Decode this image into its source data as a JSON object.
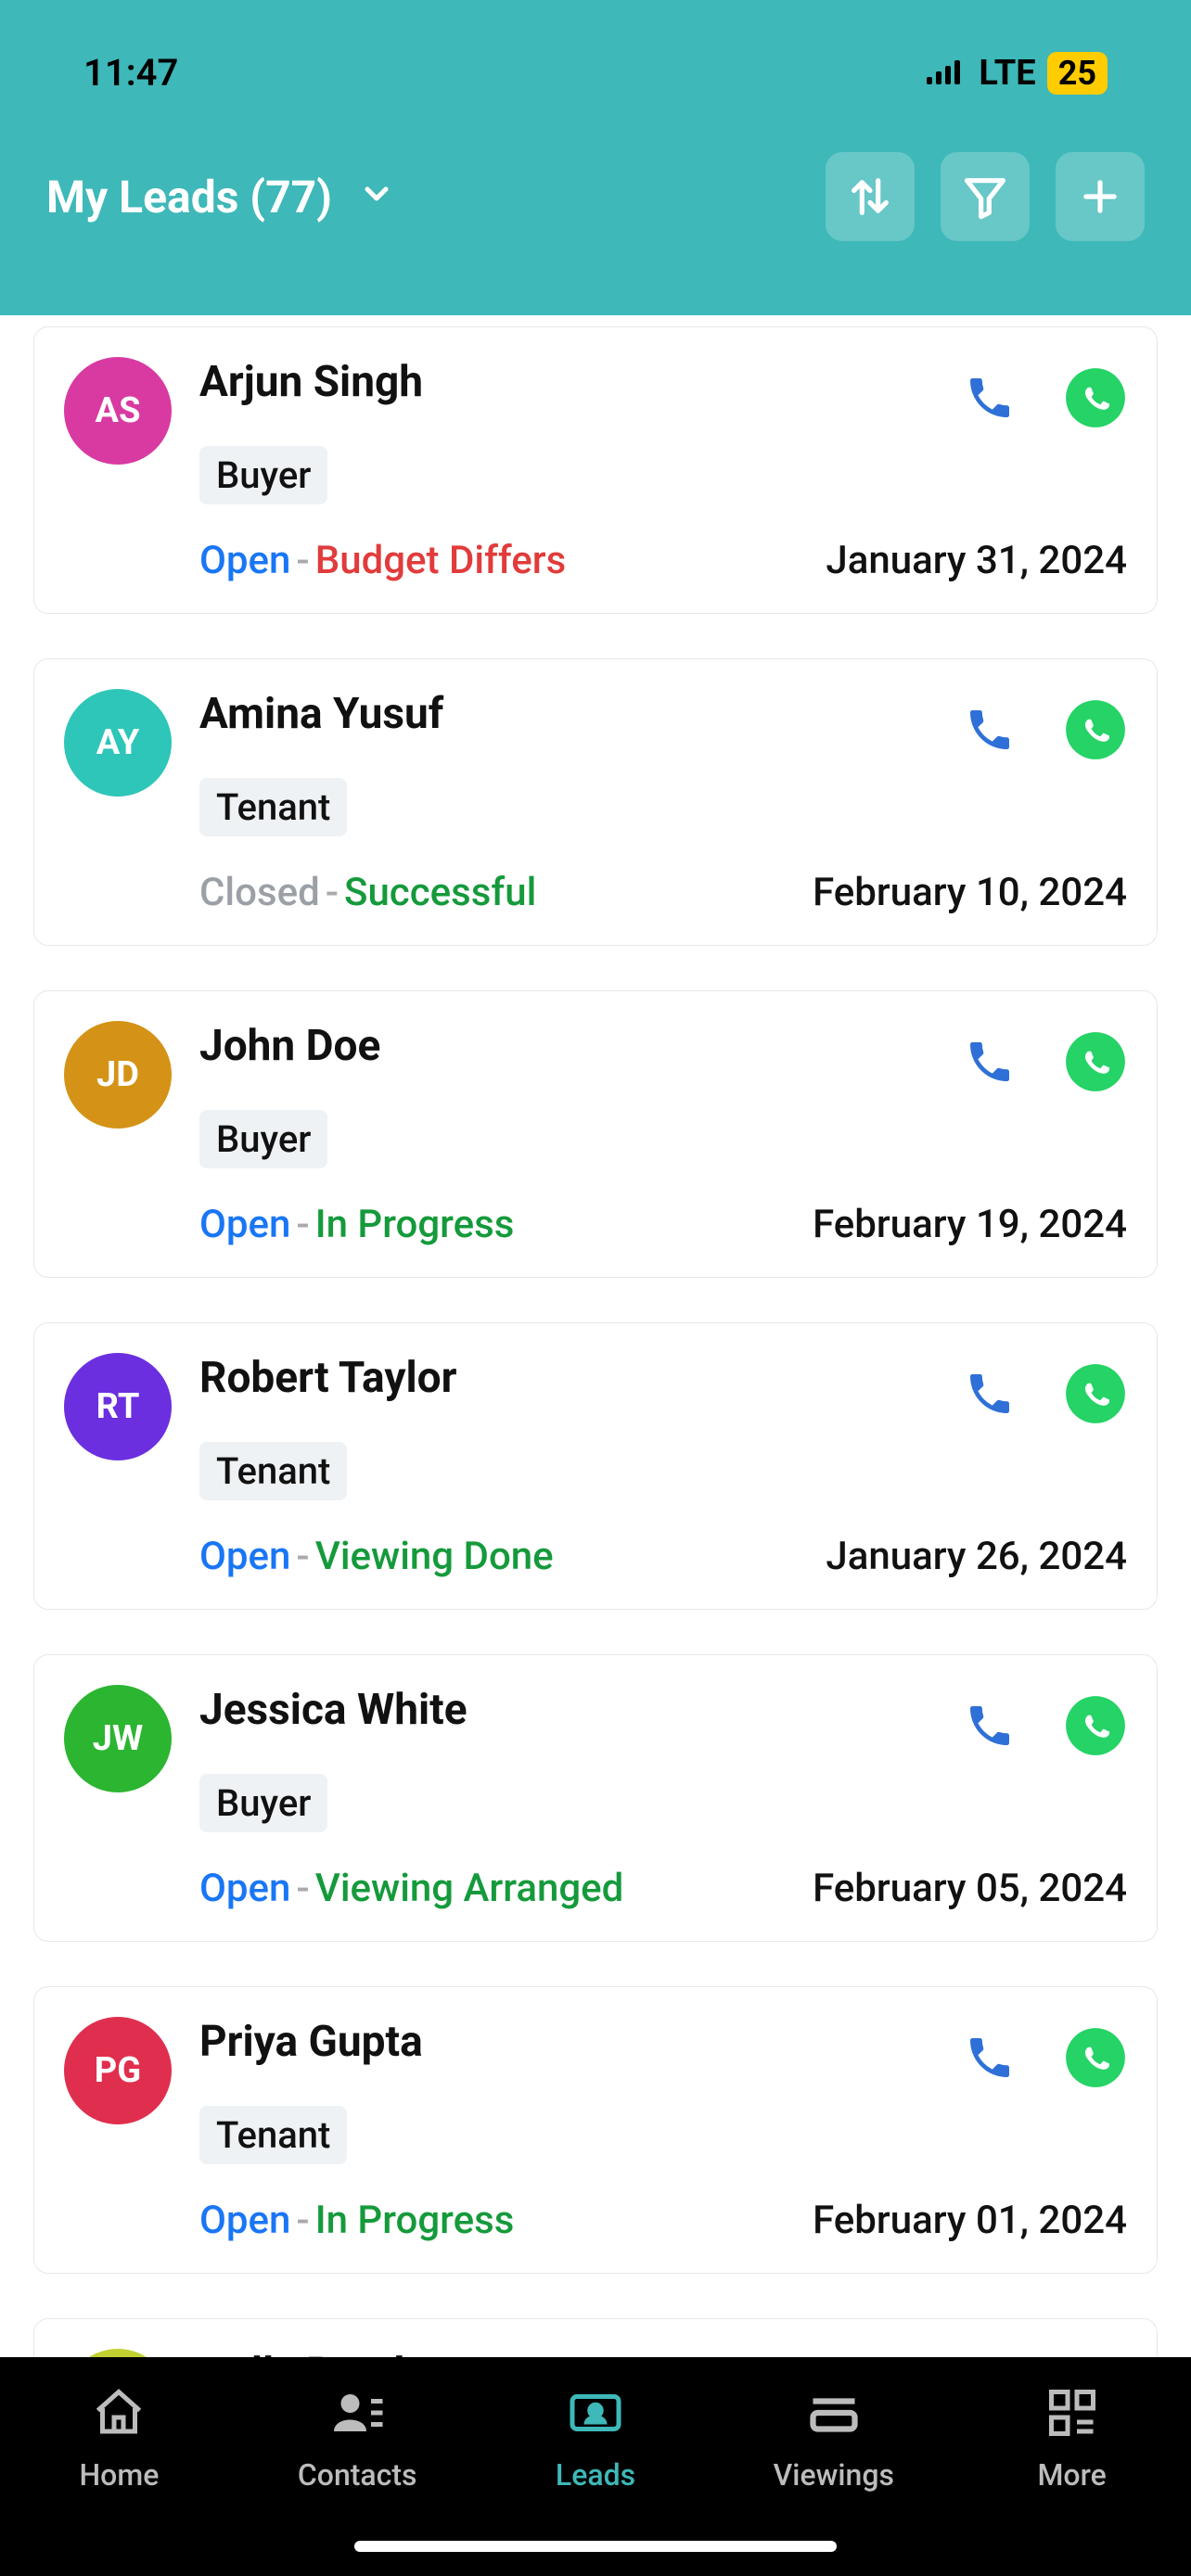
{
  "status": {
    "time": "11:47",
    "network": "LTE",
    "battery": "25"
  },
  "header": {
    "title": "My Leads (77)"
  },
  "leads": [
    {
      "initials": "AS",
      "avatarBg": "#d83aa1",
      "name": "Arjun Singh",
      "tag": "Buyer",
      "state": "Open",
      "stateColor": "#1976f5",
      "sub": "Budget Differs",
      "subColor": "#e13b3b",
      "date": "January 31, 2024"
    },
    {
      "initials": "AY",
      "avatarBg": "#2ec6b8",
      "name": "Amina Yusuf",
      "tag": "Tenant",
      "state": "Closed",
      "stateColor": "#9aa0a6",
      "sub": "Successful",
      "subColor": "#159a3b",
      "date": "February 10, 2024"
    },
    {
      "initials": "JD",
      "avatarBg": "#d49316",
      "name": "John Doe",
      "tag": "Buyer",
      "state": "Open",
      "stateColor": "#1976f5",
      "sub": "In Progress",
      "subColor": "#159a3b",
      "date": "February 19, 2024"
    },
    {
      "initials": "RT",
      "avatarBg": "#6b2fe0",
      "name": "Robert Taylor",
      "tag": "Tenant",
      "state": "Open",
      "stateColor": "#1976f5",
      "sub": "Viewing Done",
      "subColor": "#159a3b",
      "date": "January 26, 2024"
    },
    {
      "initials": "JW",
      "avatarBg": "#2bb531",
      "name": "Jessica White",
      "tag": "Buyer",
      "state": "Open",
      "stateColor": "#1976f5",
      "sub": "Viewing Arranged",
      "subColor": "#159a3b",
      "date": "February 05, 2024"
    },
    {
      "initials": "PG",
      "avatarBg": "#e02f4e",
      "name": "Priya Gupta",
      "tag": "Tenant",
      "state": "Open",
      "stateColor": "#1976f5",
      "sub": "In Progress",
      "subColor": "#159a3b",
      "date": "February 01, 2024"
    }
  ],
  "partial": {
    "avatarBg": "#c0d131",
    "name": "Dolly  Patel"
  },
  "nav": {
    "home": "Home",
    "contacts": "Contacts",
    "leads": "Leads",
    "viewings": "Viewings",
    "more": "More"
  }
}
